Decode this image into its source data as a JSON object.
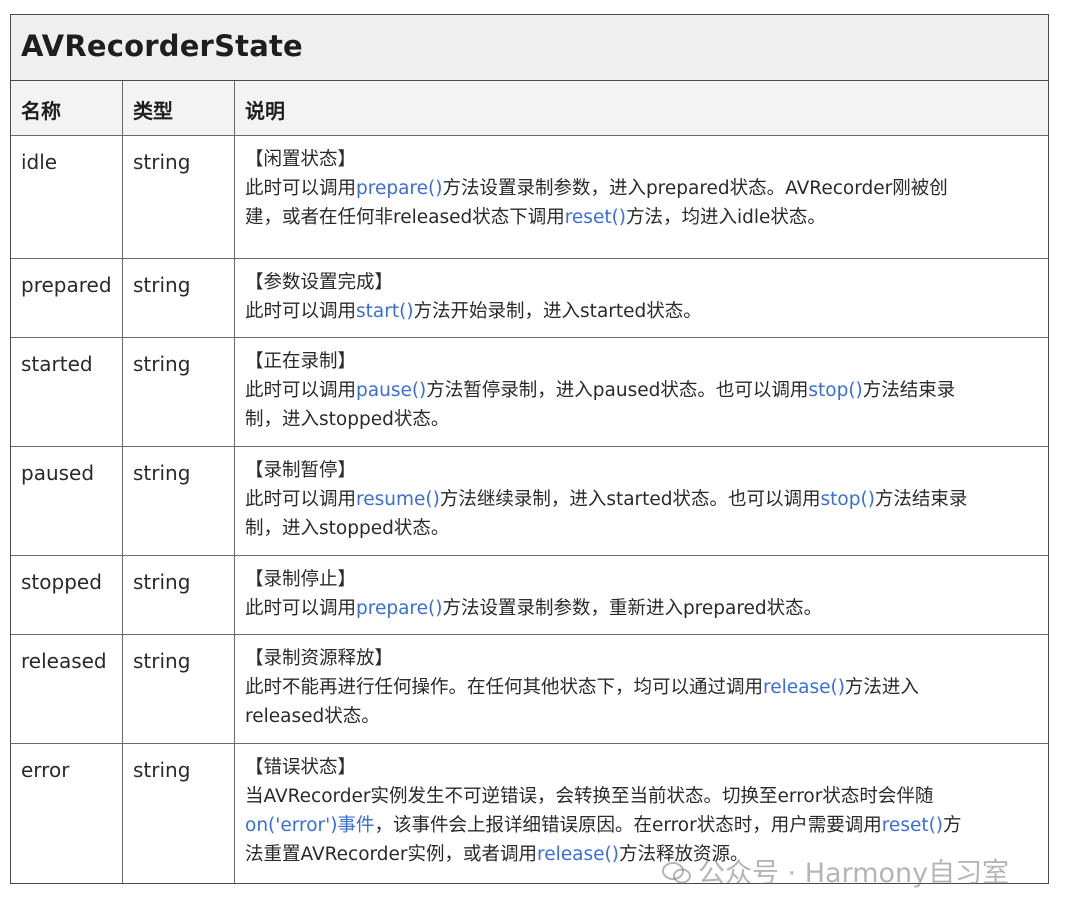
{
  "table": {
    "title": "AVRecorderState",
    "headers": {
      "name": "名称",
      "type": "类型",
      "desc": "说明"
    },
    "rows": [
      {
        "name": "idle",
        "type": "string",
        "tag": "【闲置状态】",
        "desc": {
          "a": "此时可以调用",
          "link1": "prepare()",
          "b": "方法设置录制参数，进入prepared状态。AVRecorder刚被创",
          "c": "建，或者在任何非released状态下调用",
          "link2": "reset()",
          "d": "方法，均进入idle状态。"
        }
      },
      {
        "name": "prepared",
        "type": "string",
        "tag": "【参数设置完成】",
        "desc": {
          "a": "此时可以调用",
          "link1": "start()",
          "b": "方法开始录制，进入started状态。"
        }
      },
      {
        "name": "started",
        "type": "string",
        "tag": "【正在录制】",
        "desc": {
          "a": "此时可以调用",
          "link1": "pause()",
          "b": "方法暂停录制，进入paused状态。也可以调用",
          "link2": "stop()",
          "c": "方法结束录",
          "d": "制，进入stopped状态。"
        }
      },
      {
        "name": "paused",
        "type": "string",
        "tag": "【录制暂停】",
        "desc": {
          "a": "此时可以调用",
          "link1": "resume()",
          "b": "方法继续录制，进入started状态。也可以调用",
          "link2": "stop()",
          "c": "方法结束录",
          "d": "制，进入stopped状态。"
        }
      },
      {
        "name": "stopped",
        "type": "string",
        "tag": "【录制停止】",
        "desc": {
          "a": "此时可以调用",
          "link1": "prepare()",
          "b": "方法设置录制参数，重新进入prepared状态。"
        }
      },
      {
        "name": "released",
        "type": "string",
        "tag": "【录制资源释放】",
        "desc": {
          "a": "此时不能再进行任何操作。在任何其他状态下，均可以通过调用",
          "link1": "release()",
          "b": "方法进入",
          "c": "released状态。"
        }
      },
      {
        "name": "error",
        "type": "string",
        "tag": "【错误状态】",
        "desc": {
          "a": "当AVRecorder实例发生不可逆错误，会转换至当前状态。切换至error状态时会伴随",
          "link1": "on('error')事件",
          "b": "，该事件会上报详细错误原因。在error状态时，用户需要调用",
          "link2": "reset()",
          "c": "方",
          "d": "法重置AVRecorder实例，或者调用",
          "link3": "release()",
          "e": "方法释放资源。"
        }
      }
    ]
  },
  "watermark": {
    "text": "公众号 · Harmony自习室",
    "icon": "wechat-icon"
  },
  "colors": {
    "link": "#3a6ed4",
    "border": "#4a4a4a",
    "header_bg": "#efefef"
  }
}
